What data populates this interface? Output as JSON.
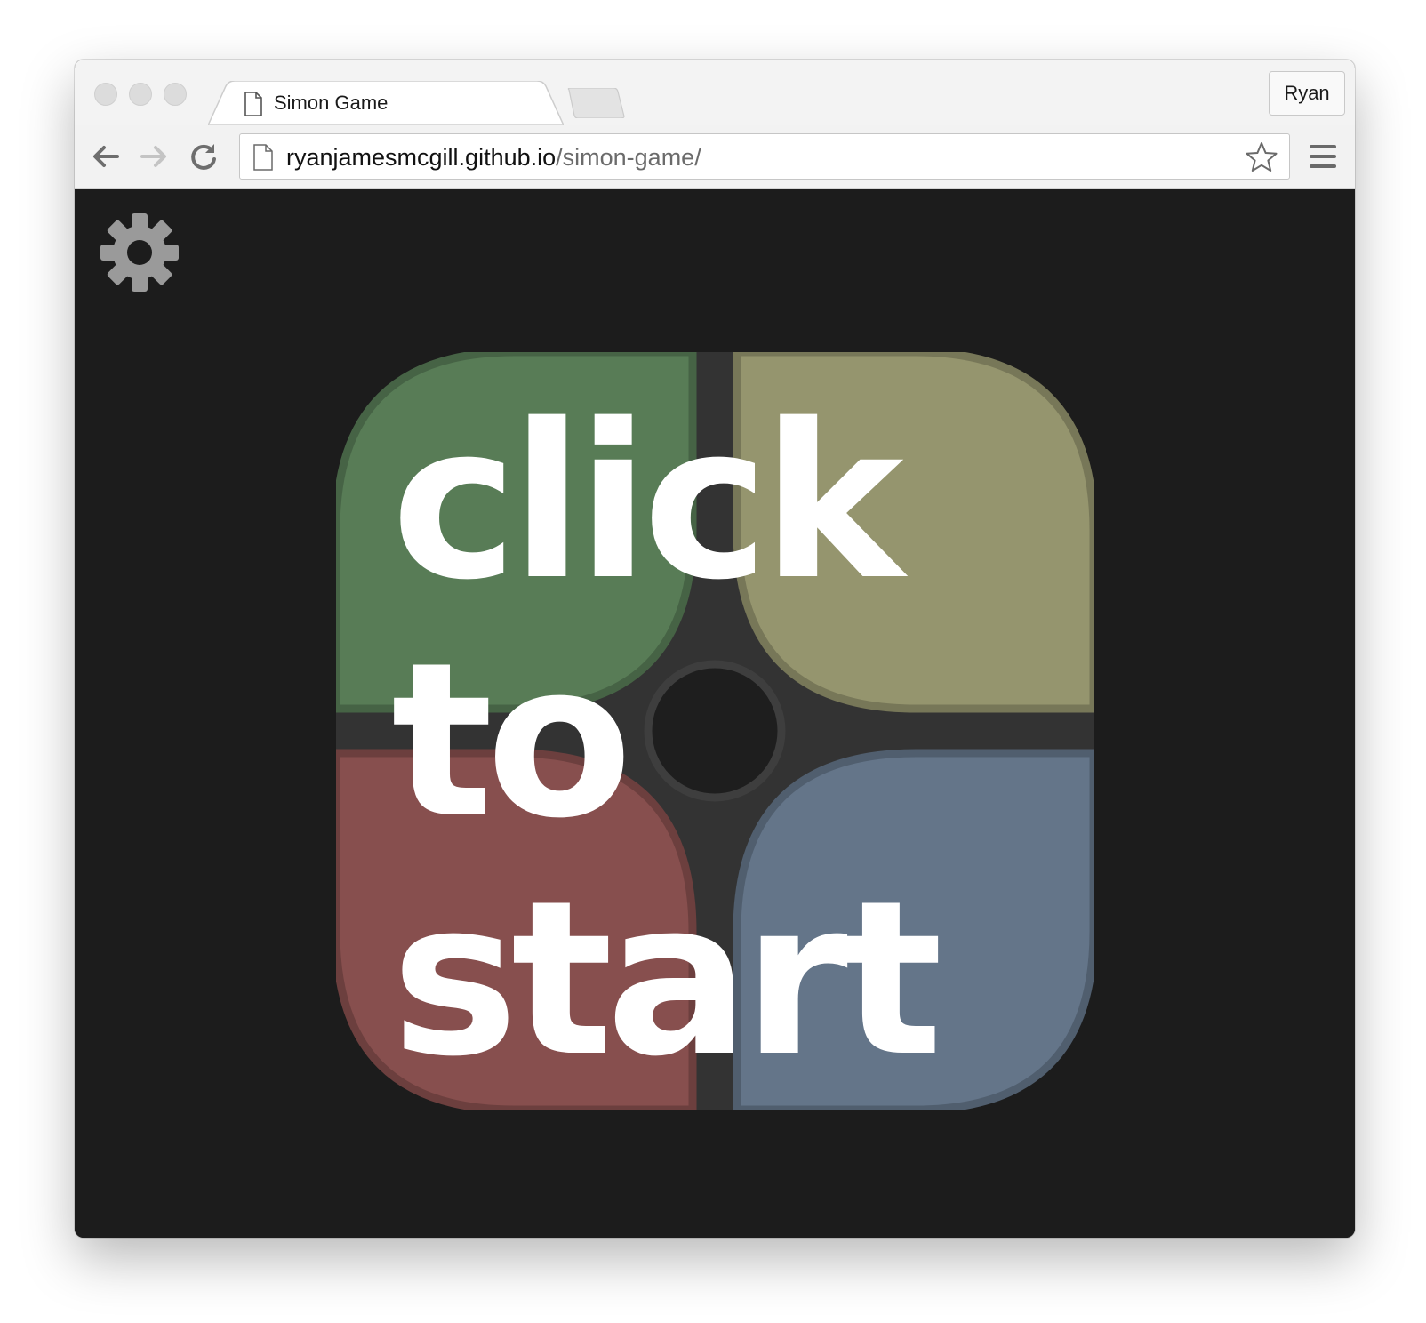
{
  "browser": {
    "tab": {
      "title": "Simon Game",
      "close_glyph": "×",
      "icon": "document-icon"
    },
    "profile_label": "Ryan",
    "address_bar": {
      "host": "ryanjamesmcgill.github.io",
      "path": "/simon-game/"
    },
    "icons": [
      "back-arrow-icon",
      "forward-arrow-icon",
      "reload-icon",
      "star-icon",
      "menu-icon"
    ]
  },
  "game": {
    "start_prompt": {
      "line1": "click",
      "line2": "to",
      "line3": "start"
    },
    "pads": [
      {
        "name": "green",
        "color": "#587c56"
      },
      {
        "name": "yellow",
        "color": "#95956e"
      },
      {
        "name": "red",
        "color": "#874f4e"
      },
      {
        "name": "blue",
        "color": "#647589"
      }
    ],
    "board_color": "#333333",
    "center_color": "#1e1e1e",
    "settings_icon": "gear-icon"
  }
}
